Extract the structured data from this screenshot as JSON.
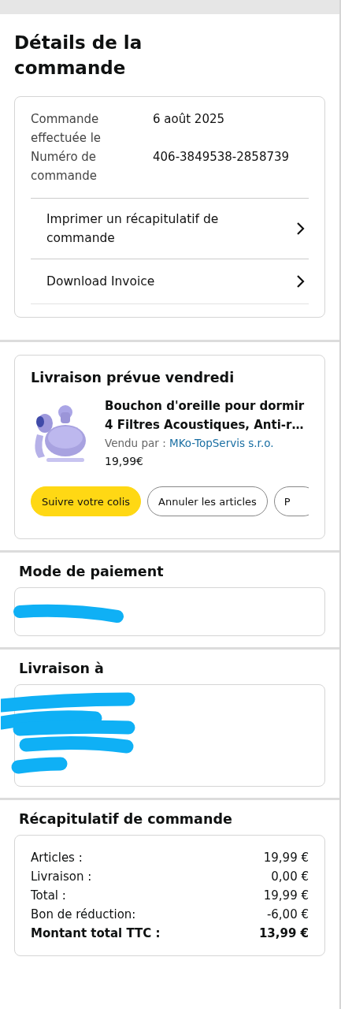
{
  "title": "Détails de la commande",
  "order_info": {
    "rows": [
      {
        "label": "Commande effectuée le",
        "value": "6 août 2025"
      },
      {
        "label": "Numéro de commande",
        "value": "406-3849538-2858739"
      }
    ],
    "links": [
      "Imprimer un récapitulatif de commande",
      "Download Invoice"
    ]
  },
  "shipment": {
    "title": "Livraison prévue vendredi",
    "product": {
      "kind": "picture",
      "name": "Bouchon d'oreille pour dormir 4 Filtres Acoustiques, Anti-r…",
      "sold_by_label": "Vendu par  :",
      "seller": "MKo-TopServis s.r.o.",
      "price": "19,99€"
    },
    "buttons": [
      {
        "label": "Suivre votre colis",
        "kind": "primary"
      },
      {
        "label": "Annuler les articles",
        "kind": "secondary"
      },
      {
        "label": "P",
        "kind": "secondary"
      }
    ]
  },
  "payment": {
    "title": "Mode de paiement"
  },
  "delivery": {
    "title": "Livraison à"
  },
  "summary": {
    "title": "Récapitulatif de commande",
    "rows": [
      {
        "label": "Articles :",
        "value": "19,99 €",
        "kind": "normal"
      },
      {
        "label": "Livraison :",
        "value": "0,00 €",
        "kind": "normal"
      },
      {
        "label": "Total :",
        "value": "19,99 €",
        "kind": "normal"
      },
      {
        "label": "Bon de réduction:",
        "value": "-6,00 €",
        "kind": "normal"
      },
      {
        "label": "Montant total TTC :",
        "value": "13,99 €",
        "kind": "total"
      }
    ]
  }
}
